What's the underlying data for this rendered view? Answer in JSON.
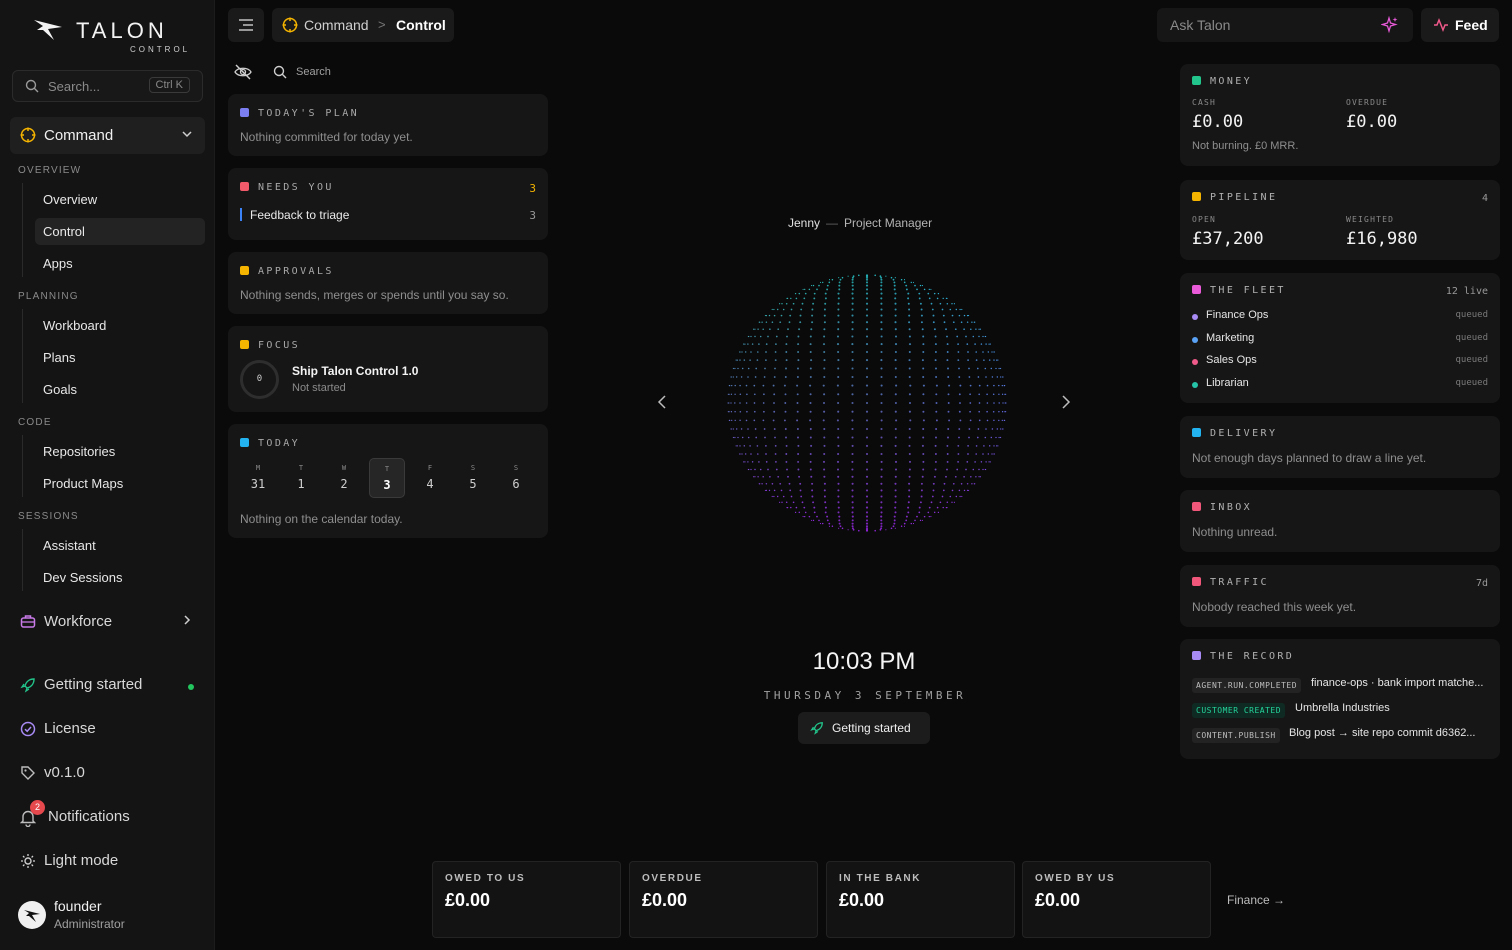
{
  "app": {
    "brand": "TALON",
    "brand_sub": "CONTROL"
  },
  "sidebar": {
    "search_placeholder": "Search...",
    "search_shortcut": "Ctrl K",
    "group_label": "Command",
    "sections": [
      {
        "label": "OVERVIEW",
        "items": [
          "Overview",
          "Control",
          "Apps"
        ]
      },
      {
        "label": "PLANNING",
        "items": [
          "Workboard",
          "Plans",
          "Goals"
        ]
      },
      {
        "label": "CODE",
        "items": [
          "Repositories",
          "Product Maps"
        ]
      },
      {
        "label": "SESSIONS",
        "items": [
          "Assistant",
          "Dev Sessions"
        ]
      }
    ],
    "workforce_label": "Workforce",
    "getting_started": "Getting started",
    "license": "License",
    "version": "v0.1.0",
    "notifications": "Notifications",
    "notifications_count": "2",
    "light_mode": "Light mode",
    "user": {
      "name": "founder",
      "role": "Administrator"
    }
  },
  "topbar": {
    "crumb_1": "Command",
    "crumb_sep": ">",
    "crumb_2": "Control",
    "ask_placeholder": "Ask Talon",
    "feed_label": "Feed"
  },
  "left": {
    "search_label": "Search",
    "plan": {
      "title": "TODAY'S PLAN",
      "text": "Nothing committed for today yet.",
      "color": "#7c7ff2"
    },
    "needs": {
      "title": "NEEDS YOU",
      "count": "3",
      "item": "Feedback to triage",
      "item_count": "3",
      "color": "#f05a6b"
    },
    "approvals": {
      "title": "APPROVALS",
      "text": "Nothing sends, merges or spends until you say so.",
      "color": "#f5b400"
    },
    "focus": {
      "title": "FOCUS",
      "ring_value": "0",
      "task": "Ship Talon Control 1.0",
      "status": "Not started",
      "color": "#f5b400"
    },
    "today": {
      "title": "TODAY",
      "color": "#22b3f0",
      "days": [
        {
          "dow": "M",
          "num": "31"
        },
        {
          "dow": "T",
          "num": "1"
        },
        {
          "dow": "W",
          "num": "2"
        },
        {
          "dow": "T",
          "num": "3"
        },
        {
          "dow": "F",
          "num": "4"
        },
        {
          "dow": "S",
          "num": "5"
        },
        {
          "dow": "S",
          "num": "6"
        }
      ],
      "text": "Nothing on the calendar today."
    }
  },
  "center": {
    "persona_name": "Jenny",
    "persona_sep": "—",
    "persona_role": "Project Manager",
    "time": "10:03 PM",
    "date": "THURSDAY 3 SEPTEMBER",
    "button": "Getting started"
  },
  "right": {
    "money": {
      "title": "MONEY",
      "cash_label": "CASH",
      "cash": "£0.00",
      "overdue_label": "OVERDUE",
      "overdue": "£0.00",
      "note": "Not burning. £0 MRR.",
      "color": "#22c58b"
    },
    "pipeline": {
      "title": "PIPELINE",
      "count": "4",
      "open_label": "OPEN",
      "open": "£37,200",
      "weighted_label": "WEIGHTED",
      "weighted": "£16,980",
      "color": "#f5b400"
    },
    "fleet": {
      "title": "THE FLEET",
      "meta": "12 live",
      "color": "#e85ad8",
      "rows": [
        {
          "name": "Finance Ops",
          "status": "queued",
          "color": "#a98bf5"
        },
        {
          "name": "Marketing",
          "status": "queued",
          "color": "#5aa2f5"
        },
        {
          "name": "Sales Ops",
          "status": "queued",
          "color": "#f05a8b"
        },
        {
          "name": "Librarian",
          "status": "queued",
          "color": "#25c3a8"
        }
      ]
    },
    "delivery": {
      "title": "DELIVERY",
      "text": "Not enough days planned to draw a line yet.",
      "color": "#22b3f0"
    },
    "inbox": {
      "title": "INBOX",
      "text": "Nothing unread.",
      "color": "#f0577a"
    },
    "traffic": {
      "title": "TRAFFIC",
      "meta": "7d",
      "text": "Nobody reached this week yet.",
      "color": "#f0577a"
    },
    "record": {
      "title": "THE RECORD",
      "color": "#a98bf5",
      "rows": [
        {
          "tag": "AGENT.RUN.COMPLETED",
          "text": "finance-ops · bank import matche..."
        },
        {
          "tag": "CUSTOMER CREATED",
          "text": "Umbrella Industries"
        },
        {
          "tag": "CONTENT.PUBLISH",
          "text": "Blog post → site repo commit d6362..."
        }
      ]
    }
  },
  "bottom": {
    "stats": [
      {
        "label": "OWED TO US",
        "value": "£0.00"
      },
      {
        "label": "OVERDUE",
        "value": "£0.00"
      },
      {
        "label": "IN THE BANK",
        "value": "£0.00"
      },
      {
        "label": "OWED BY US",
        "value": "£0.00"
      }
    ],
    "finance_link": "Finance →"
  }
}
